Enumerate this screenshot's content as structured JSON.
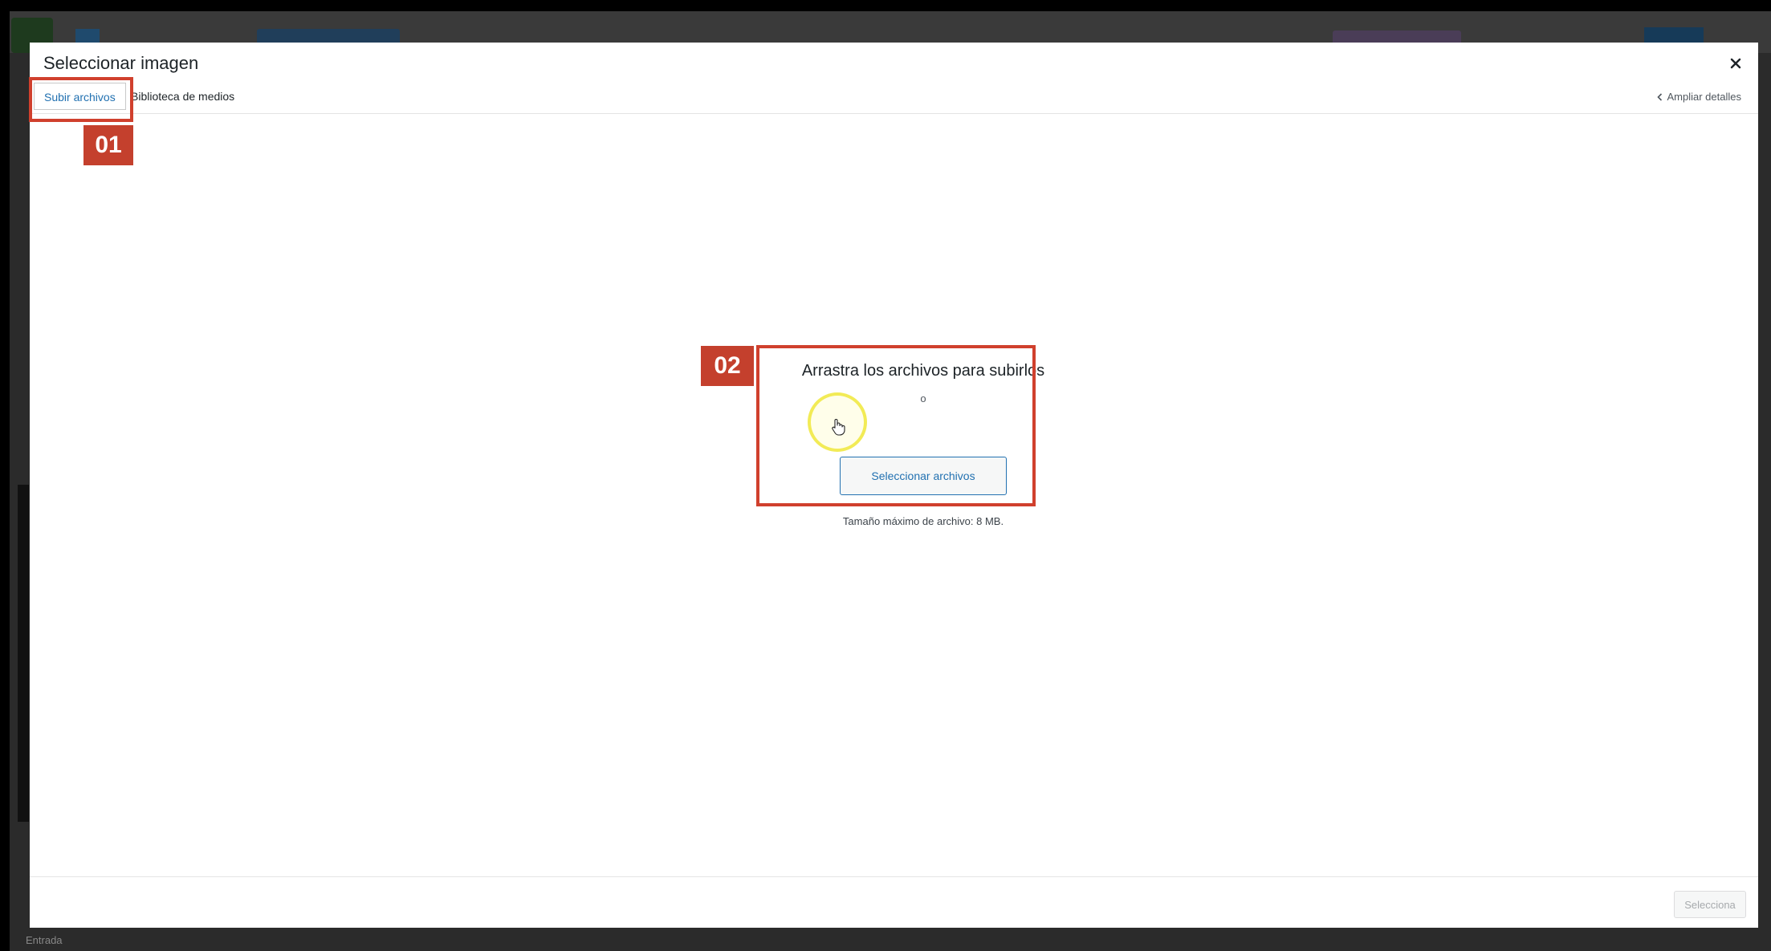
{
  "background": {
    "footer_label": "Entrada"
  },
  "modal": {
    "title": "Seleccionar imagen",
    "close_icon": "close-icon"
  },
  "tabs": [
    {
      "label": "Subir archivos",
      "active": true
    },
    {
      "label": "Biblioteca de medios",
      "active": false
    }
  ],
  "expand_details": {
    "label": "Ampliar detalles",
    "icon": "chevron-left-icon"
  },
  "uploader": {
    "title": "Arrastra los archivos para subirlos",
    "or_text": "o",
    "button_label": "Seleccionar archivos",
    "max_size": "Tamaño máximo de archivo: 8 MB."
  },
  "toolbar": {
    "select_label": "Selecciona"
  },
  "annotations": [
    {
      "label": "01"
    },
    {
      "label": "02"
    }
  ],
  "colors": {
    "accent": "#2271b1",
    "annotation": "#d0402d",
    "cursor_highlight": "#f0e83c"
  }
}
